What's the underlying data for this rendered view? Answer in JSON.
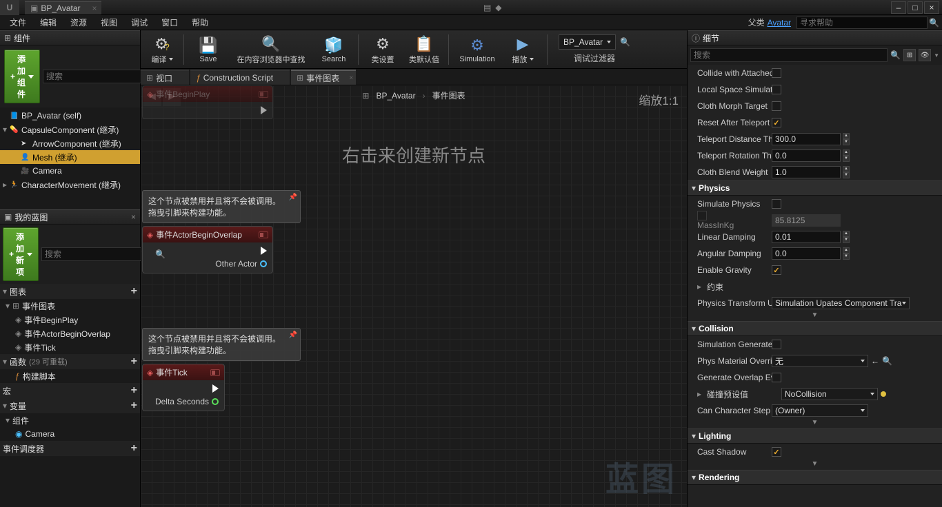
{
  "titlebar": {
    "tab": "BP_Avatar",
    "logo_alt": "U"
  },
  "wincontrols": {
    "min": "–",
    "max": "□",
    "close": "×"
  },
  "menubar": {
    "items": [
      "文件",
      "编辑",
      "资源",
      "视图",
      "调试",
      "窗口",
      "帮助"
    ],
    "parent_label": "父类",
    "parent_value": "Avatar",
    "help_placeholder": "寻求帮助"
  },
  "panels": {
    "components": "组件",
    "add_component": "添加组件",
    "search_placeholder": "搜索",
    "component_rows": [
      {
        "indent": 0,
        "twisty": "",
        "icon": "📘",
        "label": "BP_Avatar (self)"
      },
      {
        "indent": 0,
        "twisty": "▾",
        "icon": "💊",
        "label": "CapsuleComponent (继承)"
      },
      {
        "indent": 1,
        "twisty": "",
        "icon": "➤",
        "label": "ArrowComponent (继承)"
      },
      {
        "indent": 1,
        "twisty": "",
        "icon": "👤",
        "label": "Mesh (继承)",
        "selected": true
      },
      {
        "indent": 1,
        "twisty": "",
        "icon": "🎥",
        "label": "Camera"
      },
      {
        "indent": 0,
        "twisty": "▸",
        "icon": "🏃",
        "label": "CharacterMovement (继承)"
      }
    ],
    "mybp": "我的蓝图",
    "add_new": "添加新项",
    "graphs": "图表",
    "event_graph": "事件图表",
    "events": [
      "事件BeginPlay",
      "事件ActorBeginOverlap",
      "事件Tick"
    ],
    "functions": "函数",
    "functions_note": "(29 可重载)",
    "construct_script": "构建脚本",
    "macros": "宏",
    "variables": "变量",
    "components_cat": "组件",
    "camera_var": "Camera",
    "dispatchers": "事件调度器"
  },
  "toolbar": {
    "compile": "编译",
    "save": "Save",
    "browse": "在内容浏览器中查找",
    "search": "Search",
    "class_settings": "类设置",
    "class_defaults": "类默认值",
    "simulation": "Simulation",
    "play": "播放",
    "bp_select": "BP_Avatar",
    "debug_filter": "调试过滤器"
  },
  "vtabs": {
    "viewport": "视口",
    "construction": "Construction Script",
    "eventgraph": "事件图表"
  },
  "graph": {
    "bc_root": "BP_Avatar",
    "bc_leaf": "事件图表",
    "zoom": "缩放1:1",
    "hint": "右击来创建新节点",
    "watermark": "蓝图",
    "node_disabled_note": "这个节点被禁用并且将不会被调用。\n拖曳引脚来构建功能。",
    "node_beginplay": "事件BeginPlay",
    "node_overlap": "事件ActorBeginOverlap",
    "node_overlap_pin": "Other Actor",
    "node_tick": "事件Tick",
    "node_tick_pin": "Delta Seconds"
  },
  "details_panel": {
    "title": "细节",
    "search_placeholder": "搜索"
  },
  "details": {
    "rows_top": [
      {
        "label": "Collide with Attached",
        "type": "chk",
        "val": false
      },
      {
        "label": "Local Space Simulat",
        "type": "chk",
        "val": false
      },
      {
        "label": "Cloth Morph Target",
        "type": "chk",
        "val": false
      },
      {
        "label": "Reset After Teleport",
        "type": "chk",
        "val": true
      },
      {
        "label": "Teleport Distance Th",
        "type": "num",
        "val": "300.0"
      },
      {
        "label": "Teleport Rotation Th",
        "type": "num",
        "val": "0.0"
      },
      {
        "label": "Cloth Blend Weight",
        "type": "num",
        "val": "1.0"
      }
    ],
    "physics": "Physics",
    "physics_rows": [
      {
        "label": "Simulate Physics",
        "type": "chk",
        "val": false
      },
      {
        "label": "MassInKg",
        "type": "num_d",
        "val": "85.8125",
        "disabled_chk": true
      },
      {
        "label": "Linear Damping",
        "type": "num",
        "val": "0.01"
      },
      {
        "label": "Angular Damping",
        "type": "num",
        "val": "0.0"
      },
      {
        "label": "Enable Gravity",
        "type": "chk",
        "val": true
      }
    ],
    "constraints": "约束",
    "phys_transform": "Physics Transform U",
    "phys_transform_val": "Simulation Upates Component Trans",
    "collision": "Collision",
    "collision_rows": [
      {
        "label": "Simulation Generate",
        "type": "chk",
        "val": false
      },
      {
        "label": "Phys Material Overri",
        "type": "ddl",
        "val": "无",
        "reset": true
      },
      {
        "label": "Generate Overlap Ev",
        "type": "chk",
        "val": false
      },
      {
        "label": "碰撞预设值",
        "type": "ddl",
        "val": "NoCollision",
        "twisty": true,
        "yellow": true
      },
      {
        "label": "Can Character Step U",
        "type": "ddl",
        "val": "(Owner)"
      }
    ],
    "lighting": "Lighting",
    "cast_shadow": "Cast Shadow",
    "rendering": "Rendering"
  }
}
